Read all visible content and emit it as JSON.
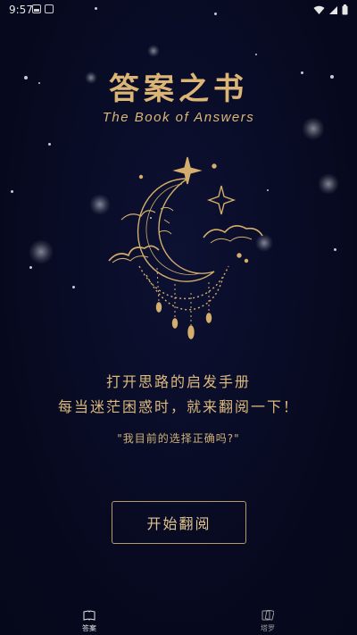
{
  "status_bar": {
    "time": "9:57"
  },
  "header": {
    "title": "答案之书",
    "subtitle": "The Book of Answers"
  },
  "tagline": {
    "line1": "打开思路的启发手册",
    "line2": "每当迷茫困惑时，就来翻阅一下！"
  },
  "example_question": "\"我目前的选择正确吗?\"",
  "start_button": {
    "label": "开始翻阅"
  },
  "bottom_nav": {
    "items": [
      {
        "label": "答案",
        "icon": "book-icon",
        "active": true
      },
      {
        "label": "塔罗",
        "icon": "tarot-card-icon",
        "active": false
      }
    ]
  },
  "colors": {
    "background": "#070a20",
    "gold": "#dcb476",
    "button_border": "#b59a6a"
  }
}
